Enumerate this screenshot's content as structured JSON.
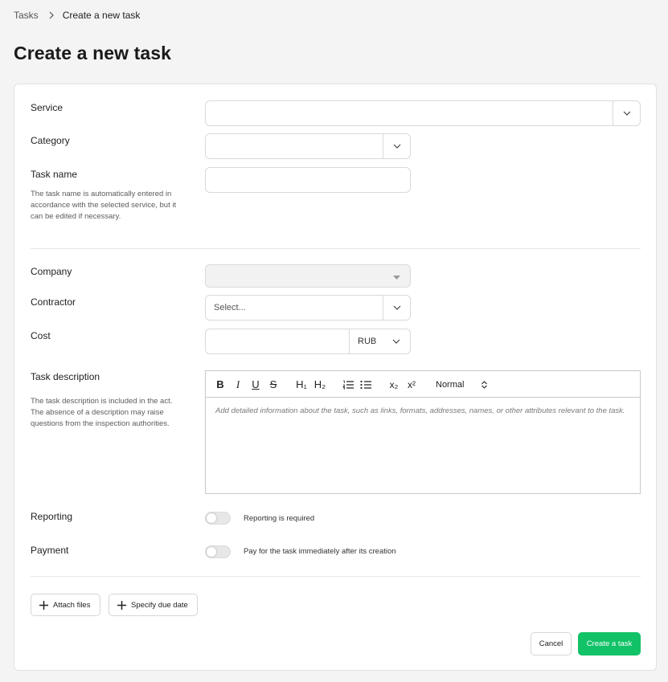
{
  "breadcrumb": {
    "parent": "Tasks",
    "current": "Create a new task"
  },
  "page_title": "Create a new task",
  "form": {
    "service": {
      "label": "Service",
      "value": ""
    },
    "category": {
      "label": "Category",
      "value": ""
    },
    "task_name": {
      "label": "Task name",
      "value": "",
      "hint": "The task name is automatically entered in accordance with the selected service, but it can be edited if necessary."
    },
    "company": {
      "label": "Company",
      "value": ""
    },
    "contractor": {
      "label": "Contractor",
      "placeholder": "Select..."
    },
    "cost": {
      "label": "Cost",
      "value": "",
      "currency": "RUB"
    },
    "description": {
      "label": "Task description",
      "hint": "The task description is included in the act. The absence of a description may raise questions from the inspection authorities.",
      "placeholder": "Add detailed information about the task, such as links, formats, addresses, names, or other attributes relevant to the task.",
      "toolbar": {
        "bold": "B",
        "italic": "I",
        "underline": "U",
        "strike": "S",
        "h1": "H₁",
        "h2": "H₂",
        "subscript": "x₂",
        "superscript": "x²",
        "size": "Normal"
      }
    },
    "reporting": {
      "label": "Reporting",
      "toggle_text": "Reporting is required",
      "on": false
    },
    "payment": {
      "label": "Payment",
      "toggle_text": "Pay for the task immediately after its creation",
      "on": false
    }
  },
  "actions": {
    "attach_files": "Attach files",
    "specify_due_date": "Specify due date",
    "cancel": "Cancel",
    "create": "Create a task"
  },
  "colors": {
    "primary": "#12c267",
    "background": "#f4f4f5"
  }
}
